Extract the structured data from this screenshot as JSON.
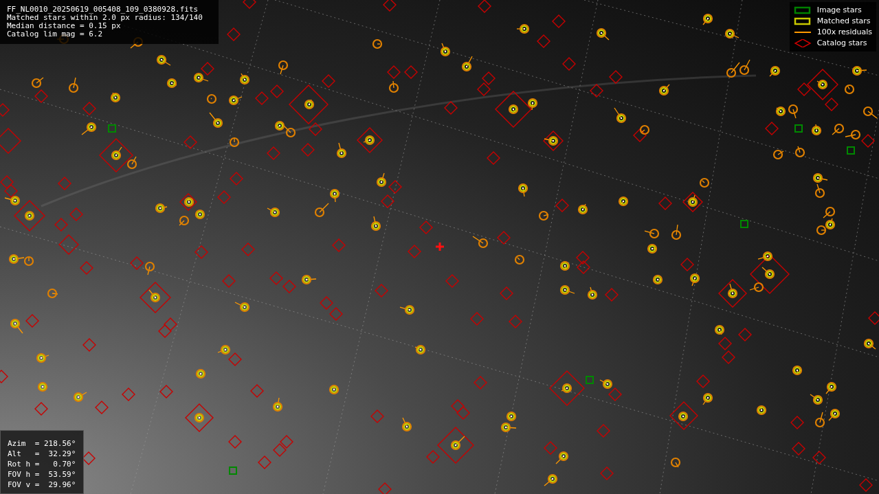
{
  "info_box": {
    "lines": [
      "FF_NL0010_20250619_005408_109_0380928.fits",
      "Matched stars within 2.0 px radius: 134/140",
      "Median distance = 0.15 px",
      "Catalog lim mag = 6.2"
    ]
  },
  "legend": {
    "items": [
      {
        "label": "Image stars",
        "kind": "rect",
        "color": "#008000"
      },
      {
        "label": "Matched stars",
        "kind": "rect",
        "color": "#c8c800"
      },
      {
        "label": "100x residuals",
        "kind": "line",
        "color": "#ff9900"
      },
      {
        "label": "Catalog stars",
        "kind": "diamond",
        "color": "#cc0000"
      }
    ]
  },
  "pointing_box": {
    "lines": [
      "Azim  = 218.56°",
      "Alt   =  32.29°",
      "Rot h =   0.70°",
      "FOV h =  53.59°",
      "FOV v =  29.96°"
    ]
  }
}
